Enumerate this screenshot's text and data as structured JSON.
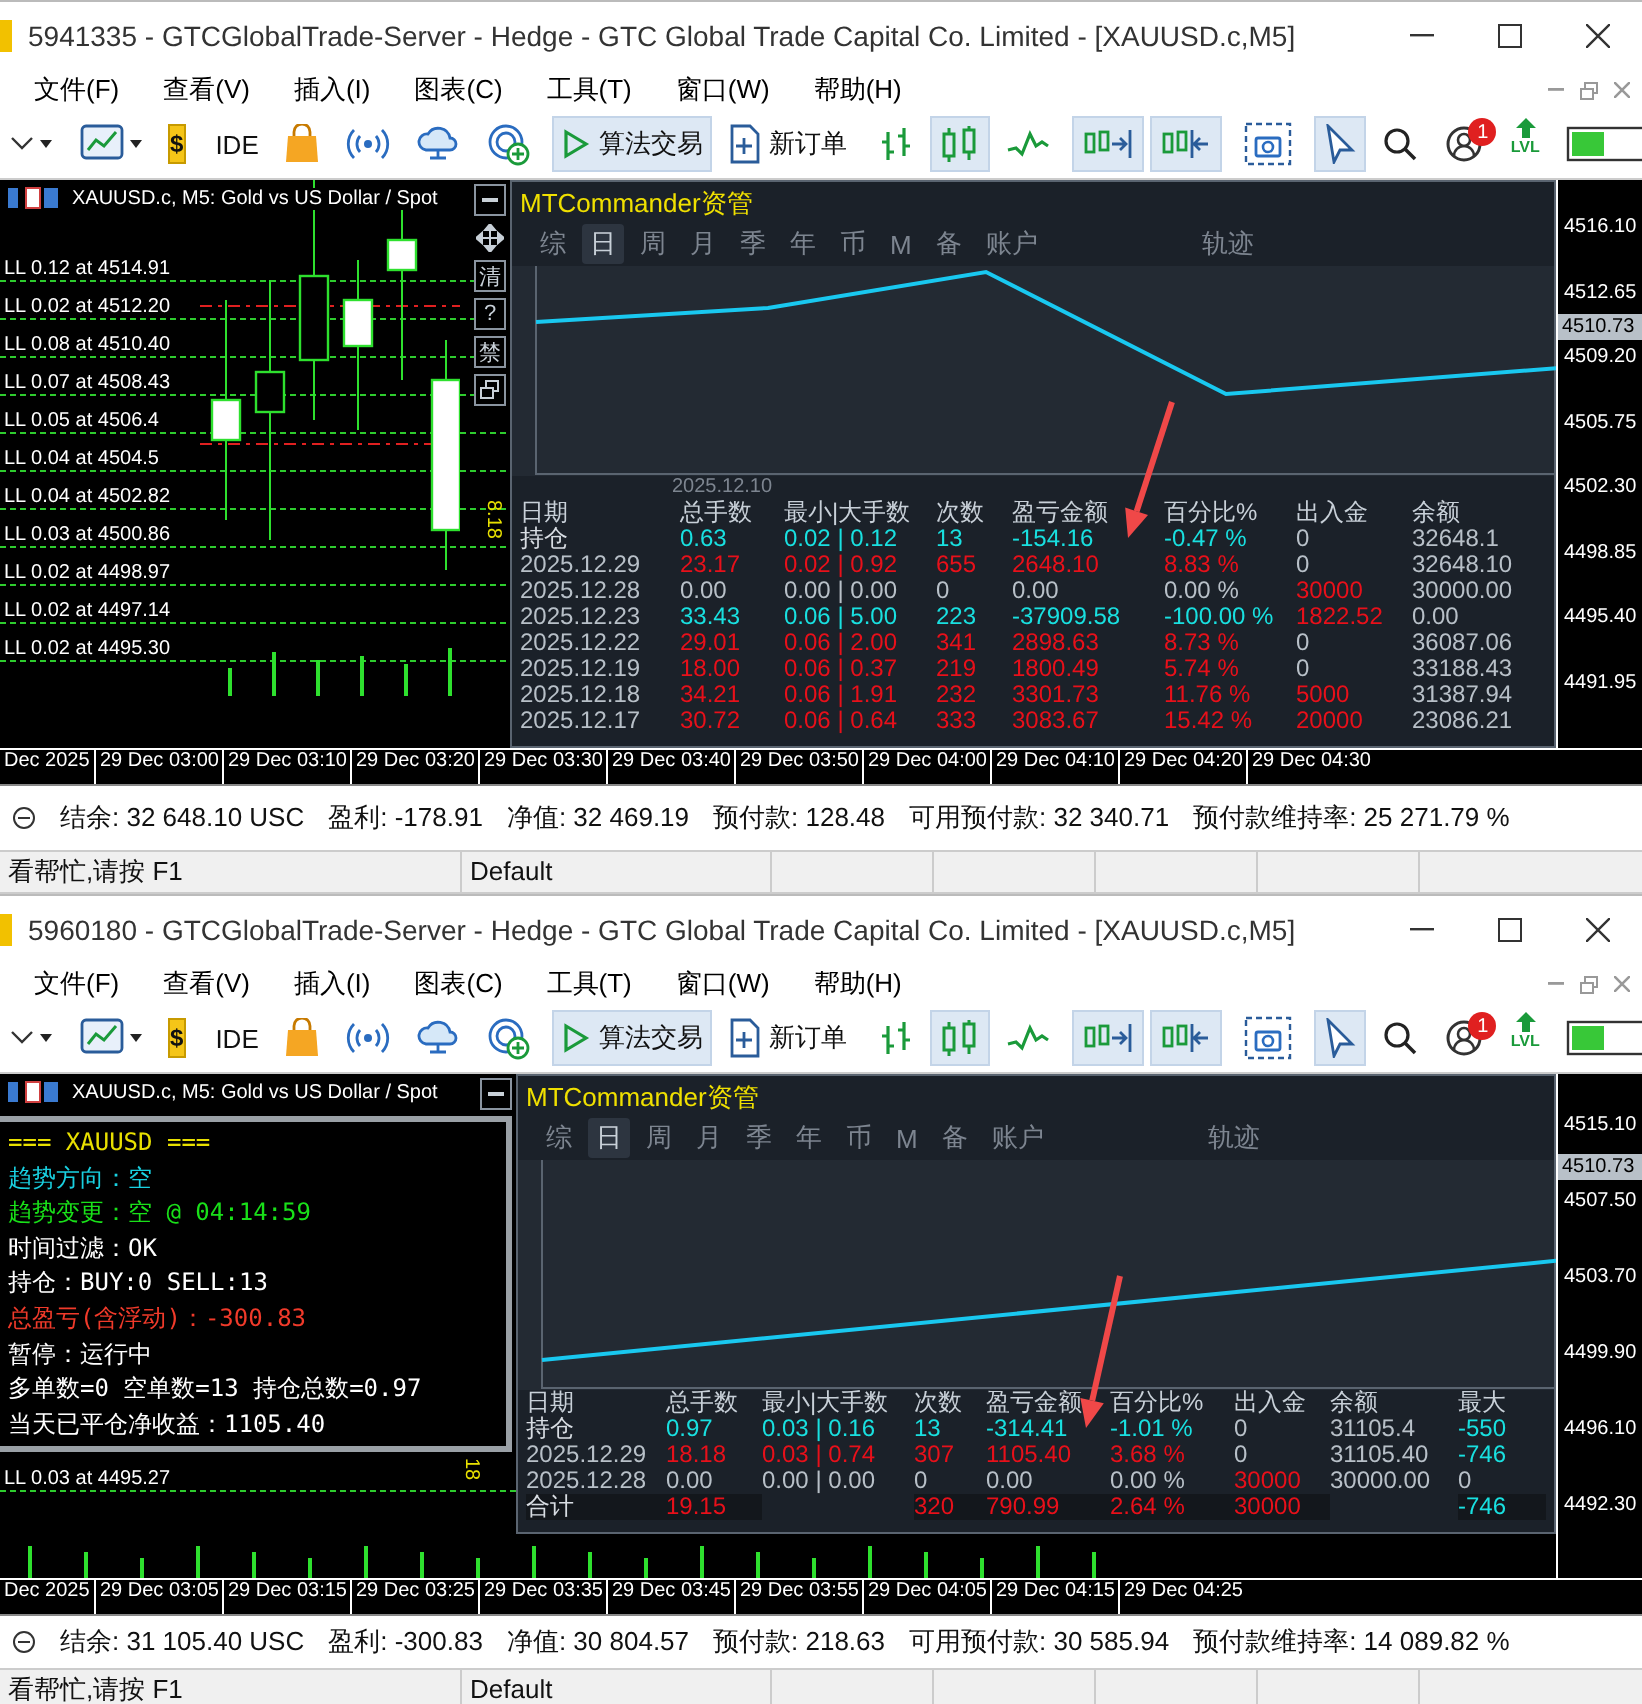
{
  "windows": [
    {
      "title": "5941335 - GTCGlobalTrade-Server - Hedge - GTC Global Trade Capital Co. Limited - [XAUUSD.c,M5]",
      "menu": [
        "文件(F)",
        "查看(V)",
        "插入(I)",
        "图表(C)",
        "工具(T)",
        "窗口(W)",
        "帮助(H)"
      ],
      "toolbar": [
        {
          "kind": "line-menu",
          "on": false
        },
        {
          "kind": "chart-menu",
          "on": false
        },
        {
          "kind": "dollar",
          "label": "$",
          "on": false
        },
        {
          "kind": "sep"
        },
        {
          "kind": "ide",
          "label": "IDE",
          "on": false
        },
        {
          "kind": "market",
          "on": false
        },
        {
          "kind": "signals",
          "on": false
        },
        {
          "kind": "cloud",
          "on": false
        },
        {
          "kind": "vps",
          "on": false
        },
        {
          "kind": "sep"
        },
        {
          "kind": "algo",
          "label": "算法交易",
          "on": true
        },
        {
          "kind": "new-order",
          "label": "新订单",
          "on": false
        },
        {
          "kind": "sep"
        },
        {
          "kind": "bars",
          "on": false
        },
        {
          "kind": "candles",
          "on": true
        },
        {
          "kind": "line",
          "on": false
        },
        {
          "kind": "sep"
        },
        {
          "kind": "autoscroll",
          "on": true
        },
        {
          "kind": "shift",
          "on": true
        },
        {
          "kind": "sep"
        },
        {
          "kind": "screenshot",
          "on": false
        },
        {
          "kind": "sep"
        },
        {
          "kind": "cursor",
          "on": true
        },
        {
          "kind": "search",
          "on": false
        },
        {
          "kind": "chat",
          "badge": "1",
          "on": false
        },
        {
          "kind": "level",
          "label": "LVL",
          "on": false
        },
        {
          "kind": "meter",
          "on": false
        }
      ],
      "chart": {
        "title": "XAUUSD.c, M5:  Gold vs US Dollar / Spot",
        "side_buttons": [
          {
            "kind": "minimize"
          },
          {
            "kind": "move"
          },
          {
            "kind": "text",
            "label": "清"
          },
          {
            "kind": "text",
            "label": "?"
          },
          {
            "kind": "text",
            "label": "禁"
          },
          {
            "kind": "restore"
          }
        ],
        "order_lines": [
          "LL 0.12 at 4514.91",
          "LL 0.02 at 4512.20",
          "LL 0.08 at 4510.40",
          "LL 0.07 at 4508.43",
          "LL 0.05 at 4506.4",
          "LL 0.04 at 4504.5",
          "LL 0.04 at 4502.82",
          "LL 0.03 at 4500.86",
          "LL 0.02 at 4498.97",
          "LL 0.02 at 4497.14",
          "LL 0.02 at 4495.30"
        ],
        "marker": "8.18",
        "price_axis": [
          "4516.10",
          "4512.65",
          "4509.20",
          "4505.75",
          "4502.30",
          "4498.85",
          "4495.40",
          "4491.95"
        ],
        "current_price": "4510.73",
        "time_axis": [
          "Dec 2025",
          "29 Dec 03:00",
          "29 Dec 03:10",
          "29 Dec 03:20",
          "29 Dec 03:30",
          "29 Dec 03:40",
          "29 Dec 03:50",
          "29 Dec 04:00",
          "29 Dec 04:10",
          "29 Dec 04:20",
          "29 Dec 04:30"
        ],
        "panel": {
          "title": "MTCommander资管",
          "tabs": [
            {
              "label": "综",
              "selected": false
            },
            {
              "label": "日",
              "selected": true
            },
            {
              "label": "周",
              "selected": false
            },
            {
              "label": "月",
              "selected": false
            },
            {
              "label": "季",
              "selected": false
            },
            {
              "label": "年",
              "selected": false
            },
            {
              "label": "币",
              "selected": false
            },
            {
              "label": "M",
              "selected": false
            },
            {
              "label": "备",
              "selected": false
            },
            {
              "label": "账户",
              "selected": false
            },
            {
              "label": "轨迹",
              "selected": false
            }
          ],
          "graph_date": "2025.12.10",
          "columns": [
            "日期",
            "总手数",
            "最小|大手数",
            "次数",
            "盈亏金额",
            "百分比%",
            "出入金",
            "余额"
          ],
          "rows": [
            {
              "kind": "position",
              "cells": [
                {
                  "text": "持仓",
                  "color": "#d8dde3"
                },
                {
                  "text": "0.63",
                  "color": "#19e0e0"
                },
                {
                  "text": "0.02 | 0.12",
                  "color": "#19e0e0"
                },
                {
                  "text": "13",
                  "color": "#19e0e0"
                },
                {
                  "text": "-154.16",
                  "color": "#19e0e0"
                },
                {
                  "text": "-0.47 %",
                  "color": "#19e0e0"
                },
                {
                  "text": "0",
                  "color": "#b8c0c8"
                },
                {
                  "text": "32648.1",
                  "color": "#b8c0c8"
                }
              ]
            },
            {
              "kind": "day",
              "cells": [
                {
                  "text": "2025.12.29",
                  "color": "#b8c0c8"
                },
                {
                  "text": "23.17",
                  "color": "#e8101a"
                },
                {
                  "text": "0.02 | 0.92",
                  "color": "#e8101a"
                },
                {
                  "text": "655",
                  "color": "#e8101a"
                },
                {
                  "text": "2648.10",
                  "color": "#e8101a"
                },
                {
                  "text": "8.83 %",
                  "color": "#e8101a"
                },
                {
                  "text": "0",
                  "color": "#b8c0c8"
                },
                {
                  "text": "32648.10",
                  "color": "#b8c0c8"
                }
              ]
            },
            {
              "kind": "day",
              "cells": [
                {
                  "text": "2025.12.28",
                  "color": "#b8c0c8"
                },
                {
                  "text": "0.00",
                  "color": "#b8c0c8"
                },
                {
                  "text": "0.00 | 0.00",
                  "color": "#b8c0c8"
                },
                {
                  "text": "0",
                  "color": "#b8c0c8"
                },
                {
                  "text": "0.00",
                  "color": "#b8c0c8"
                },
                {
                  "text": "0.00 %",
                  "color": "#b8c0c8"
                },
                {
                  "text": "30000",
                  "color": "#e8101a"
                },
                {
                  "text": "30000.00",
                  "color": "#b8c0c8"
                }
              ]
            },
            {
              "kind": "day",
              "cells": [
                {
                  "text": "2025.12.23",
                  "color": "#b8c0c8"
                },
                {
                  "text": "33.43",
                  "color": "#19e0e0"
                },
                {
                  "text": "0.06 | 5.00",
                  "color": "#19e0e0"
                },
                {
                  "text": "223",
                  "color": "#19e0e0"
                },
                {
                  "text": "-37909.58",
                  "color": "#19e0e0"
                },
                {
                  "text": "-100.00 %",
                  "color": "#19e0e0"
                },
                {
                  "text": "1822.52",
                  "color": "#e8101a"
                },
                {
                  "text": "0.00",
                  "color": "#b8c0c8"
                }
              ]
            },
            {
              "kind": "day",
              "cells": [
                {
                  "text": "2025.12.22",
                  "color": "#b8c0c8"
                },
                {
                  "text": "29.01",
                  "color": "#e8101a"
                },
                {
                  "text": "0.06 | 2.00",
                  "color": "#e8101a"
                },
                {
                  "text": "341",
                  "color": "#e8101a"
                },
                {
                  "text": "2898.63",
                  "color": "#e8101a"
                },
                {
                  "text": "8.73 %",
                  "color": "#e8101a"
                },
                {
                  "text": "0",
                  "color": "#b8c0c8"
                },
                {
                  "text": "36087.06",
                  "color": "#b8c0c8"
                }
              ]
            },
            {
              "kind": "day",
              "cells": [
                {
                  "text": "2025.12.19",
                  "color": "#b8c0c8"
                },
                {
                  "text": "18.00",
                  "color": "#e8101a"
                },
                {
                  "text": "0.06 | 0.37",
                  "color": "#e8101a"
                },
                {
                  "text": "219",
                  "color": "#e8101a"
                },
                {
                  "text": "1800.49",
                  "color": "#e8101a"
                },
                {
                  "text": "5.74 %",
                  "color": "#e8101a"
                },
                {
                  "text": "0",
                  "color": "#b8c0c8"
                },
                {
                  "text": "33188.43",
                  "color": "#b8c0c8"
                }
              ]
            },
            {
              "kind": "day",
              "cells": [
                {
                  "text": "2025.12.18",
                  "color": "#b8c0c8"
                },
                {
                  "text": "34.21",
                  "color": "#e8101a"
                },
                {
                  "text": "0.06 | 1.91",
                  "color": "#e8101a"
                },
                {
                  "text": "232",
                  "color": "#e8101a"
                },
                {
                  "text": "3301.73",
                  "color": "#e8101a"
                },
                {
                  "text": "11.76 %",
                  "color": "#e8101a"
                },
                {
                  "text": "5000",
                  "color": "#e8101a"
                },
                {
                  "text": "31387.94",
                  "color": "#b8c0c8"
                }
              ]
            },
            {
              "kind": "day",
              "cells": [
                {
                  "text": "2025.12.17",
                  "color": "#b8c0c8"
                },
                {
                  "text": "30.72",
                  "color": "#e8101a"
                },
                {
                  "text": "0.06 | 0.64",
                  "color": "#e8101a"
                },
                {
                  "text": "333",
                  "color": "#e8101a"
                },
                {
                  "text": "3083.67",
                  "color": "#e8101a"
                },
                {
                  "text": "15.42 %",
                  "color": "#e8101a"
                },
                {
                  "text": "20000",
                  "color": "#e8101a"
                },
                {
                  "text": "23086.21",
                  "color": "#b8c0c8"
                }
              ]
            }
          ]
        }
      },
      "account": [
        "结余: 32 648.10 USC",
        "盈利: -178.91",
        "净值: 32 469.19",
        "预付款: 128.48",
        "可用预付款: 32 340.71",
        "预付款维持率: 25 271.79 %"
      ],
      "status": [
        "看帮忙,请按 F1",
        "Default"
      ]
    },
    {
      "title": "5960180 - GTCGlobalTrade-Server - Hedge - GTC Global Trade Capital Co. Limited - [XAUUSD.c,M5]",
      "menu": [
        "文件(F)",
        "查看(V)",
        "插入(I)",
        "图表(C)",
        "工具(T)",
        "窗口(W)",
        "帮助(H)"
      ],
      "toolbar": [
        {
          "kind": "line-menu",
          "on": false
        },
        {
          "kind": "chart-menu",
          "on": false
        },
        {
          "kind": "dollar",
          "label": "$",
          "on": false
        },
        {
          "kind": "sep"
        },
        {
          "kind": "ide",
          "label": "IDE",
          "on": false
        },
        {
          "kind": "market",
          "on": false
        },
        {
          "kind": "signals",
          "on": false
        },
        {
          "kind": "cloud",
          "on": false
        },
        {
          "kind": "vps",
          "on": false
        },
        {
          "kind": "sep"
        },
        {
          "kind": "algo",
          "label": "算法交易",
          "on": true
        },
        {
          "kind": "new-order",
          "label": "新订单",
          "on": false
        },
        {
          "kind": "sep"
        },
        {
          "kind": "bars",
          "on": false
        },
        {
          "kind": "candles",
          "on": true
        },
        {
          "kind": "line",
          "on": false
        },
        {
          "kind": "sep"
        },
        {
          "kind": "autoscroll",
          "on": true
        },
        {
          "kind": "shift",
          "on": true
        },
        {
          "kind": "sep"
        },
        {
          "kind": "screenshot",
          "on": false
        },
        {
          "kind": "sep"
        },
        {
          "kind": "cursor",
          "on": true
        },
        {
          "kind": "search",
          "on": false
        },
        {
          "kind": "chat",
          "badge": "1",
          "on": false
        },
        {
          "kind": "level",
          "label": "LVL",
          "on": false
        },
        {
          "kind": "meter",
          "on": false
        }
      ],
      "chart": {
        "title": "XAUUSD.c, M5:  Gold vs US Dollar / Spot",
        "side_buttons": [
          {
            "kind": "minimize"
          }
        ],
        "order_lines": [
          "LL 0.03 at 4495.27"
        ],
        "marker": "18",
        "price_axis": [
          "4515.10",
          "4507.50",
          "4503.70",
          "4499.90",
          "4496.10",
          "4492.30"
        ],
        "current_price": "4510.73",
        "time_axis": [
          "Dec 2025",
          "29 Dec 03:05",
          "29 Dec 03:15",
          "29 Dec 03:25",
          "29 Dec 03:35",
          "29 Dec 03:45",
          "29 Dec 03:55",
          "29 Dec 04:05",
          "29 Dec 04:15",
          "29 Dec 04:25"
        ],
        "info_box": [
          {
            "text": "===  XAUUSD  ===",
            "color": "#e8e000"
          },
          {
            "text": "趋势方向：空",
            "color": "#19d0e0"
          },
          {
            "text": "趋势变更：空 @ 04:14:59",
            "color": "#19e019"
          },
          {
            "text": "时间过滤：OK",
            "color": "#ffffff"
          },
          {
            "text": "持仓：BUY:0   SELL:13",
            "color": "#ffffff"
          },
          {
            "text": "总盈亏(含浮动)：-300.83",
            "color": "#f03a2a"
          },
          {
            "text": "暂停：运行中",
            "color": "#ffffff"
          },
          {
            "text": "多单数=0 空单数=13 持仓总数=0.97",
            "color": "#ffffff"
          },
          {
            "text": "当天已平仓净收益：1105.40",
            "color": "#ffffff"
          }
        ],
        "panel": {
          "title": "MTCommander资管",
          "tabs": [
            {
              "label": "综",
              "selected": false
            },
            {
              "label": "日",
              "selected": true
            },
            {
              "label": "周",
              "selected": false
            },
            {
              "label": "月",
              "selected": false
            },
            {
              "label": "季",
              "selected": false
            },
            {
              "label": "年",
              "selected": false
            },
            {
              "label": "币",
              "selected": false
            },
            {
              "label": "M",
              "selected": false
            },
            {
              "label": "备",
              "selected": false
            },
            {
              "label": "账户",
              "selected": false
            },
            {
              "label": "轨迹",
              "selected": false
            }
          ],
          "columns": [
            "日期",
            "总手数",
            "最小|大手数",
            "次数",
            "盈亏金额",
            "百分比%",
            "出入金",
            "余额",
            "最大"
          ],
          "rows": [
            {
              "kind": "position",
              "cells": [
                {
                  "text": "持仓",
                  "color": "#d8dde3"
                },
                {
                  "text": "0.97",
                  "color": "#19e0e0"
                },
                {
                  "text": "0.03 | 0.16",
                  "color": "#19e0e0"
                },
                {
                  "text": "13",
                  "color": "#19e0e0"
                },
                {
                  "text": "-314.41",
                  "color": "#19e0e0"
                },
                {
                  "text": "-1.01 %",
                  "color": "#19e0e0"
                },
                {
                  "text": "0",
                  "color": "#b8c0c8"
                },
                {
                  "text": "31105.4",
                  "color": "#b8c0c8"
                },
                {
                  "text": "-550",
                  "color": "#19e0e0"
                }
              ]
            },
            {
              "kind": "day",
              "cells": [
                {
                  "text": "2025.12.29",
                  "color": "#b8c0c8"
                },
                {
                  "text": "18.18",
                  "color": "#e8101a"
                },
                {
                  "text": "0.03 | 0.74",
                  "color": "#e8101a"
                },
                {
                  "text": "307",
                  "color": "#e8101a"
                },
                {
                  "text": "1105.40",
                  "color": "#e8101a"
                },
                {
                  "text": "3.68 %",
                  "color": "#e8101a"
                },
                {
                  "text": "0",
                  "color": "#b8c0c8"
                },
                {
                  "text": "31105.40",
                  "color": "#b8c0c8"
                },
                {
                  "text": "-746",
                  "color": "#19e0e0"
                }
              ]
            },
            {
              "kind": "day",
              "cells": [
                {
                  "text": "2025.12.28",
                  "color": "#b8c0c8"
                },
                {
                  "text": "0.00",
                  "color": "#b8c0c8"
                },
                {
                  "text": "0.00 | 0.00",
                  "color": "#b8c0c8"
                },
                {
                  "text": "0",
                  "color": "#b8c0c8"
                },
                {
                  "text": "0.00",
                  "color": "#b8c0c8"
                },
                {
                  "text": "0.00 %",
                  "color": "#b8c0c8"
                },
                {
                  "text": "30000",
                  "color": "#e8101a"
                },
                {
                  "text": "30000.00",
                  "color": "#b8c0c8"
                },
                {
                  "text": "0",
                  "color": "#b8c0c8"
                }
              ]
            },
            {
              "kind": "total",
              "cells": [
                {
                  "text": "合计",
                  "color": "#d8dde3"
                },
                {
                  "text": "19.15",
                  "color": "#e8101a"
                },
                null,
                {
                  "text": "320",
                  "color": "#e8101a"
                },
                {
                  "text": "790.99",
                  "color": "#e8101a"
                },
                {
                  "text": "2.64 %",
                  "color": "#e8101a"
                },
                {
                  "text": "30000",
                  "color": "#e8101a"
                },
                null,
                {
                  "text": "-746",
                  "color": "#19e0e0"
                }
              ]
            }
          ]
        }
      },
      "account": [
        "结余: 31 105.40 USC",
        "盈利: -300.83",
        "净值: 30 804.57",
        "预付款: 218.63",
        "可用预付款: 30 585.94",
        "预付款维持率: 14 089.82 %"
      ],
      "status": [
        "看帮忙,请按 F1",
        "Default"
      ]
    }
  ]
}
